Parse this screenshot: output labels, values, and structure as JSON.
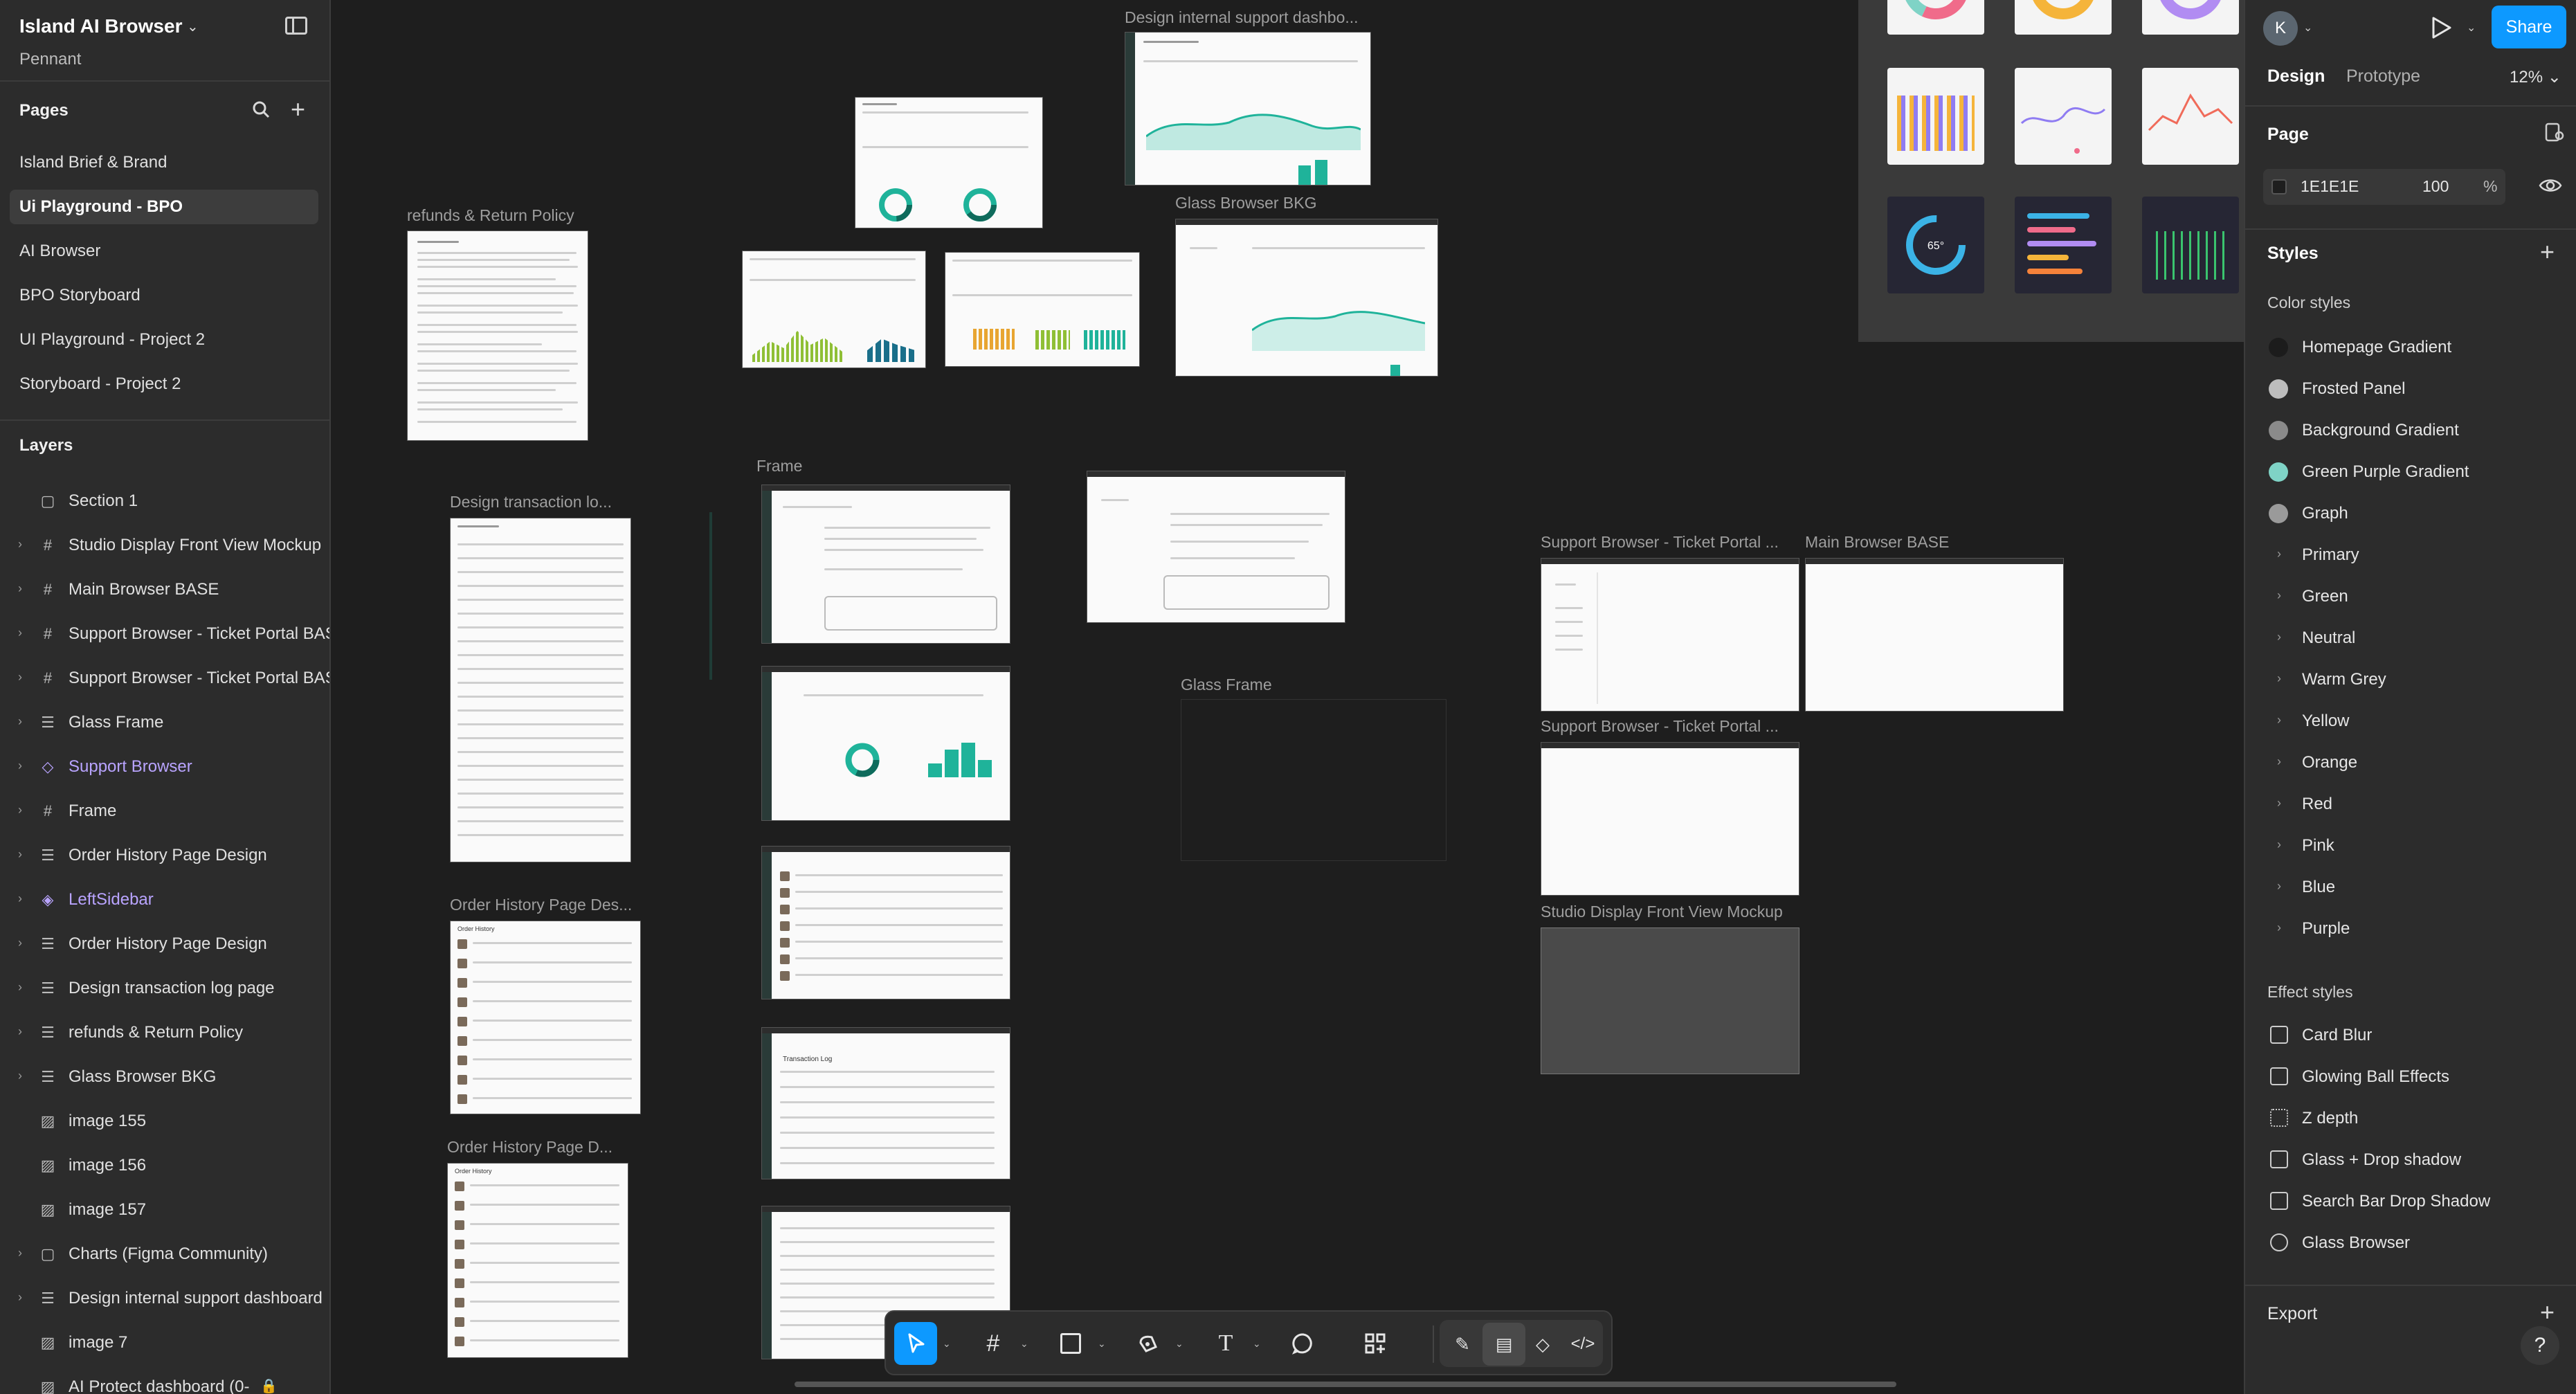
{
  "left_panel": {
    "app_title": "Island AI Browser",
    "team": "Pennant",
    "pages_label": "Pages",
    "pages": [
      {
        "label": "Island Brief & Brand",
        "active": false
      },
      {
        "label": "Ui Playground - BPO",
        "active": true
      },
      {
        "label": "AI Browser",
        "active": false
      },
      {
        "label": "BPO Storyboard",
        "active": false
      },
      {
        "label": "UI Playground - Project 2",
        "active": false
      },
      {
        "label": "Storyboard - Project 2",
        "active": false
      }
    ],
    "layers_label": "Layers",
    "layers": [
      {
        "label": "Section 1",
        "icon": "section-icon"
      },
      {
        "label": "Studio Display Front View Mockup",
        "icon": "frame-icon"
      },
      {
        "label": "Main Browser BASE",
        "icon": "frame-icon"
      },
      {
        "label": "Support Browser - Ticket Portal BAS",
        "icon": "frame-icon"
      },
      {
        "label": "Support Browser - Ticket Portal BAS",
        "icon": "frame-icon"
      },
      {
        "label": "Glass Frame",
        "icon": "auto-layout-icon"
      },
      {
        "label": "Support Browser",
        "icon": "component-icon"
      },
      {
        "label": "Frame",
        "icon": "frame-icon"
      },
      {
        "label": "Order History Page Design",
        "icon": "auto-layout-icon"
      },
      {
        "label": "LeftSidebar",
        "icon": "instance-icon"
      },
      {
        "label": "Order History Page Design",
        "icon": "auto-layout-icon"
      },
      {
        "label": "Design transaction log page",
        "icon": "auto-layout-icon"
      },
      {
        "label": "refunds & Return Policy",
        "icon": "auto-layout-icon"
      },
      {
        "label": "Glass Browser BKG",
        "icon": "auto-layout-icon"
      },
      {
        "label": "image 155",
        "icon": "image-icon"
      },
      {
        "label": "image 156",
        "icon": "image-icon"
      },
      {
        "label": "image 157",
        "icon": "image-icon"
      },
      {
        "label": "Charts (Figma Community)",
        "icon": "section-icon"
      },
      {
        "label": "Design internal support dashboard",
        "icon": "auto-layout-icon"
      },
      {
        "label": "image 7",
        "icon": "image-icon"
      },
      {
        "label": "AI Protect dashboard (0-",
        "icon": "image-icon"
      }
    ]
  },
  "canvas": {
    "frame_labels": {
      "refunds": "refunds & Return Policy",
      "support_dashboard": "Design internal support dashbo...",
      "glass_browser_bkg": "Glass Browser BKG",
      "transaction_log": "Design transaction lo...",
      "frame": "Frame",
      "glass_frame": "Glass Frame",
      "ticket_portal_1": "Support Browser - Ticket Portal ...",
      "main_browser_base": "Main Browser BASE",
      "ticket_portal_2": "Support Browser - Ticket Portal ...",
      "studio_display": "Studio Display Front View Mockup",
      "order_history_1": "Order History Page Des...",
      "order_history_2": "Order History Page D..."
    },
    "dashboard_metrics": [
      "65°"
    ],
    "thumbnail_headings": {
      "order_history": "Order History",
      "transaction_log": "Transaction Log"
    }
  },
  "toolbar": {
    "tools": [
      {
        "name": "move-tool",
        "active": true
      },
      {
        "name": "frame-tool",
        "active": false
      },
      {
        "name": "shape-tool",
        "active": false
      },
      {
        "name": "pen-tool",
        "active": false
      },
      {
        "name": "text-tool",
        "active": false
      },
      {
        "name": "comment-tool",
        "active": false
      },
      {
        "name": "actions-tool",
        "active": false
      }
    ],
    "dev_tools": [
      "draw-mode",
      "design-mode",
      "component-mode",
      "dev-mode"
    ]
  },
  "right_panel": {
    "avatar_letter": "K",
    "share_label": "Share",
    "tabs": [
      {
        "label": "Design",
        "active": true
      },
      {
        "label": "Prototype",
        "active": false
      }
    ],
    "zoom": "12%",
    "page_section": "Page",
    "page_fill": {
      "hex": "1E1E1E",
      "opacity": "100",
      "unit": "%"
    },
    "styles_section": "Styles",
    "color_styles_label": "Color styles",
    "color_styles": [
      {
        "label": "Homepage Gradient",
        "swatch": "#1c1c1c"
      },
      {
        "label": "Frosted Panel",
        "swatch": "#bdbdbd"
      },
      {
        "label": "Background Gradient",
        "swatch": "#8a8a8a"
      },
      {
        "label": "Green Purple Gradient",
        "swatch": "#7fd3c6"
      },
      {
        "label": "Graph",
        "swatch": "#9a9a9a"
      }
    ],
    "color_groups": [
      "Primary",
      "Green",
      "Neutral",
      "Warm Grey",
      "Yellow",
      "Orange",
      "Red",
      "Pink",
      "Blue",
      "Purple"
    ],
    "effect_styles_label": "Effect styles",
    "effect_styles": [
      {
        "label": "Card Blur",
        "icon": "blur-icon"
      },
      {
        "label": "Glowing Ball Effects",
        "icon": "blur-icon"
      },
      {
        "label": "Z depth",
        "icon": "dotted-square-icon"
      },
      {
        "label": "Glass + Drop shadow",
        "icon": "shadow-icon"
      },
      {
        "label": "Search Bar Drop Shadow",
        "icon": "shadow-icon"
      },
      {
        "label": "Glass Browser",
        "icon": "glass-icon"
      }
    ],
    "export_label": "Export",
    "help_label": "?"
  },
  "colors": {
    "accent": "#0d99ff",
    "component": "#b9a4ff",
    "canvas_bg": "#1e1e1e",
    "panel_bg": "#2c2c2c",
    "teal": "#1fb39a"
  }
}
